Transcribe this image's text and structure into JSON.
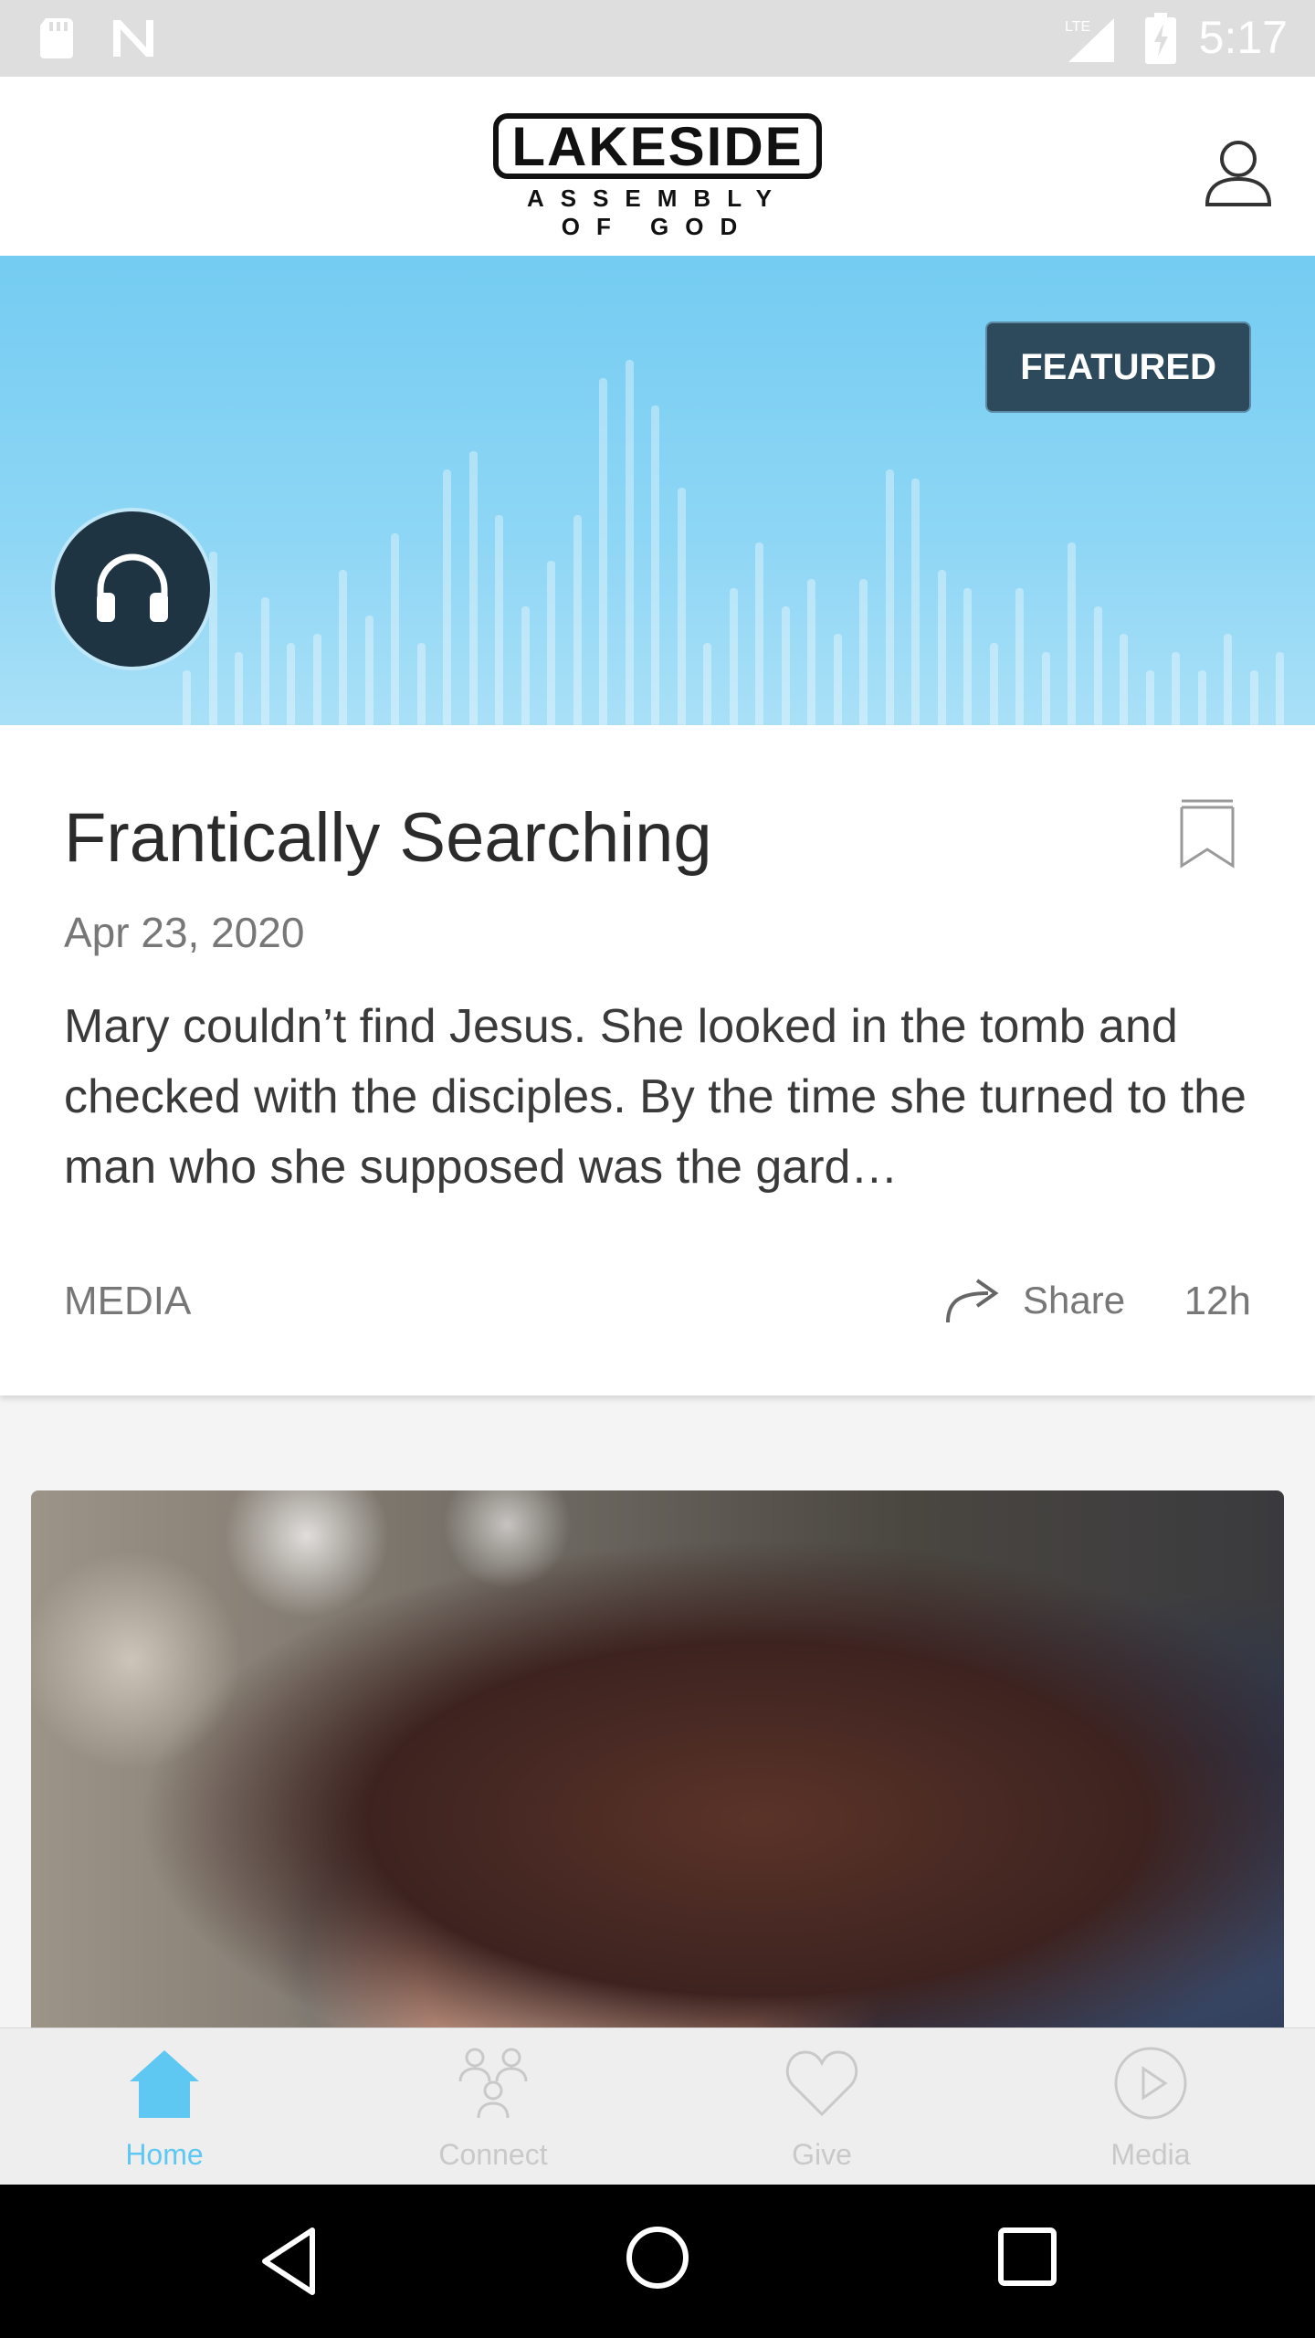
{
  "status_bar": {
    "time": "5:17",
    "network": "LTE"
  },
  "header": {
    "logo_title": "LAKESIDE",
    "logo_subtitle": "ASSEMBLY OF GOD"
  },
  "hero": {
    "badge": "FEATURED"
  },
  "post": {
    "title": "Frantically Searching",
    "date": "Apr 23, 2020",
    "description": "Mary couldn’t find Jesus. She looked in the tomb and checked with the disciples. By the time she turned to the man who she supposed was the gard…",
    "category": "MEDIA",
    "share_label": "Share",
    "age": "12h"
  },
  "bottom_nav": {
    "items": [
      {
        "label": "Home",
        "active": true
      },
      {
        "label": "Connect",
        "active": false
      },
      {
        "label": "Give",
        "active": false
      },
      {
        "label": "Media",
        "active": false
      }
    ]
  },
  "colors": {
    "accent": "#5ec8f2",
    "badge_bg": "#2d4a5c",
    "inactive_nav": "#c9c9c9"
  }
}
